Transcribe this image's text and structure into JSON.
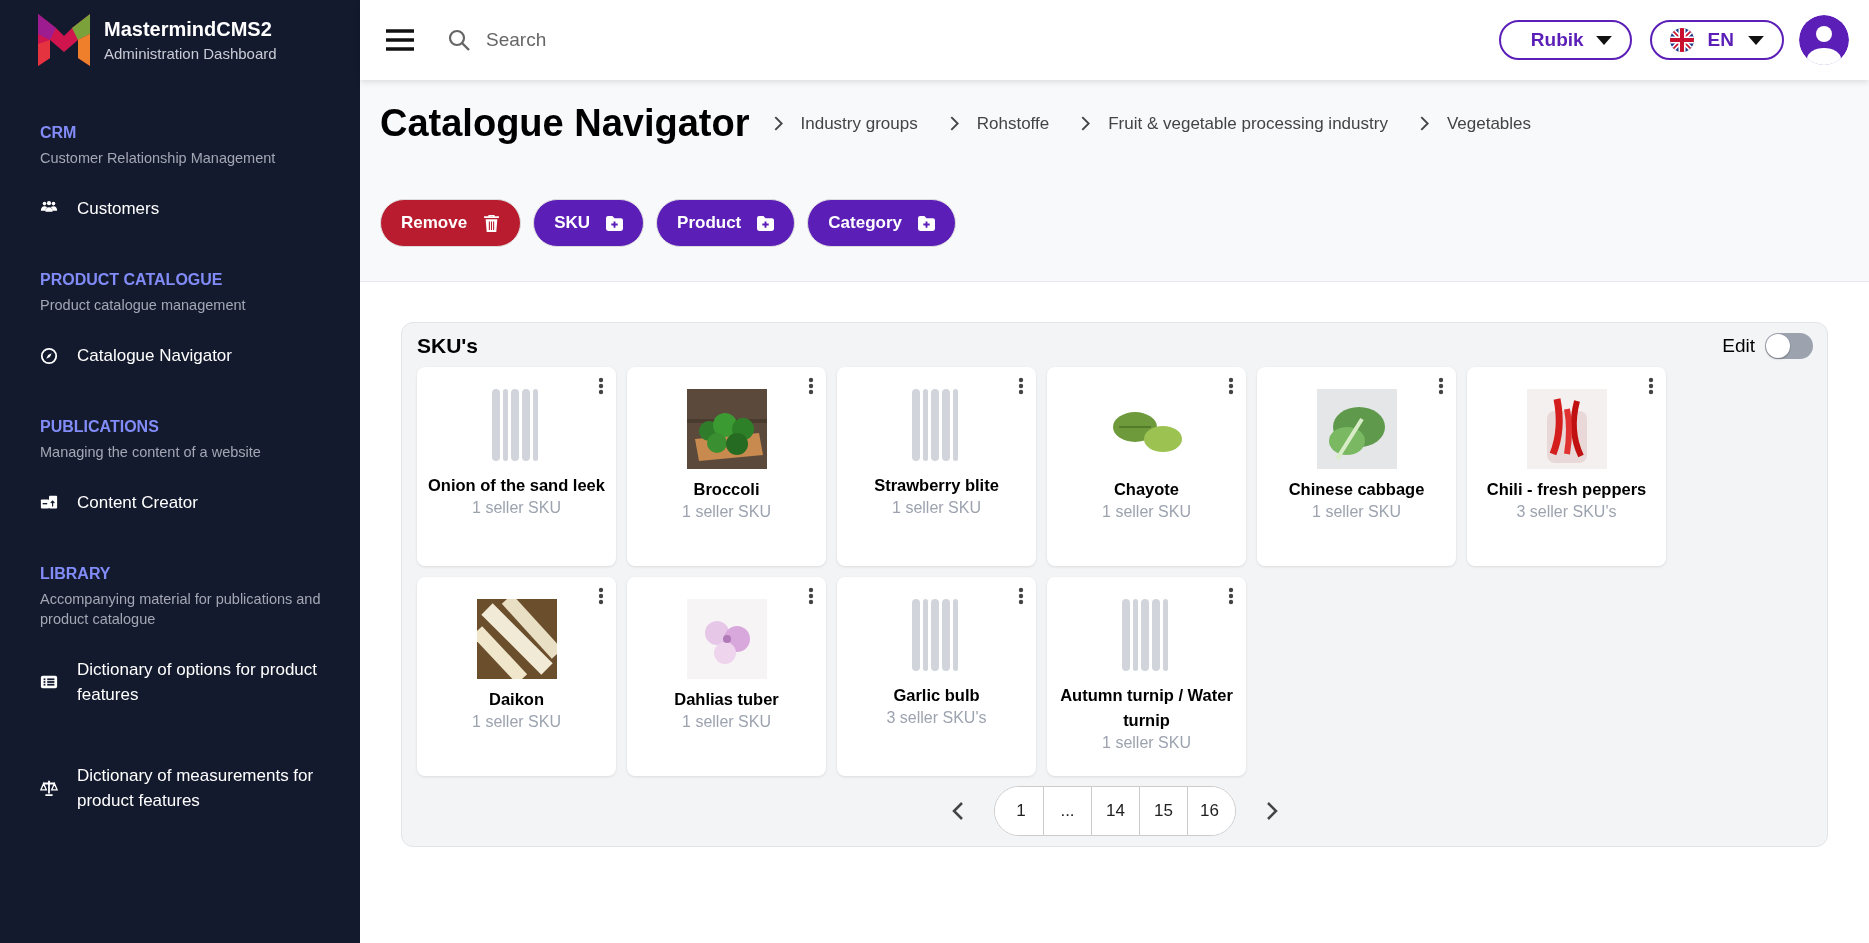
{
  "brand": {
    "name": "MastermindCMS2",
    "subtitle": "Administration Dashboard"
  },
  "sidebar": {
    "sections": [
      {
        "title": "CRM",
        "subtitle": "Customer Relationship Management",
        "items": [
          {
            "label": "Customers"
          }
        ]
      },
      {
        "title": "PRODUCT CATALOGUE",
        "subtitle": "Product catalogue management",
        "items": [
          {
            "label": "Catalogue Navigator"
          }
        ]
      },
      {
        "title": "PUBLICATIONS",
        "subtitle": "Managing the content of a website",
        "items": [
          {
            "label": "Content Creator"
          }
        ]
      },
      {
        "title": "LIBRARY",
        "subtitle": "Accompanying material for publications and product catalogue",
        "items": [
          {
            "label": "Dictionary of options for product features"
          },
          {
            "label": "Dictionary of measurements for product features"
          }
        ]
      }
    ]
  },
  "topbar": {
    "search": {
      "placeholder": "Search"
    },
    "font_menu": "Rubik",
    "language_menu": "EN"
  },
  "page": {
    "title": "Catalogue Navigator",
    "breadcrumbs": [
      "Industry groups",
      "Rohstoffe",
      "Fruit & vegetable processing industry",
      "Vegetables"
    ]
  },
  "actions": [
    {
      "label": "Remove",
      "kind": "danger"
    },
    {
      "label": "SKU",
      "kind": "add"
    },
    {
      "label": "Product",
      "kind": "add"
    },
    {
      "label": "Category",
      "kind": "add"
    }
  ],
  "skus": {
    "title": "SKU's",
    "edit": {
      "label": "Edit",
      "on": false
    },
    "cards": [
      {
        "name": "Onion of the sand leek",
        "count": "1 seller SKU",
        "kind": "placeholder"
      },
      {
        "name": "Broccoli",
        "count": "1 seller SKU",
        "kind": "picture"
      },
      {
        "name": "Strawberry blite",
        "count": "1 seller SKU",
        "kind": "placeholder"
      },
      {
        "name": "Chayote",
        "count": "1 seller SKU",
        "kind": "picture"
      },
      {
        "name": "Chinese cabbage",
        "count": "1 seller SKU",
        "kind": "picture"
      },
      {
        "name": "Chili - fresh peppers",
        "count": "3 seller SKU's",
        "kind": "picture"
      },
      {
        "name": "Daikon",
        "count": "1 seller SKU",
        "kind": "picture"
      },
      {
        "name": "Dahlias tuber",
        "count": "1 seller SKU",
        "kind": "picture"
      },
      {
        "name": "Garlic bulb",
        "count": "3 seller SKU's",
        "kind": "placeholder"
      },
      {
        "name": "Autumn turnip / Water turnip",
        "count": "1 seller SKU",
        "kind": "placeholder"
      }
    ],
    "pagination": [
      "1",
      "...",
      "14",
      "15",
      "16"
    ]
  }
}
